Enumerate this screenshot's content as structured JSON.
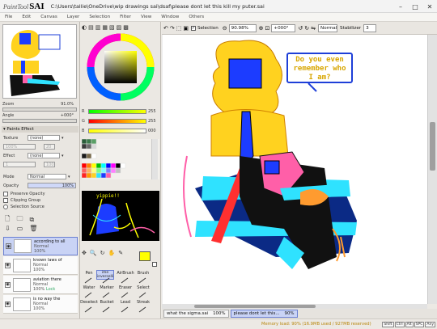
{
  "app": {
    "logo_small": "PaintTool",
    "logo_big": "SAI",
    "title": "C:\\Users\\tallie\\OneDrive\\wip drawings sai\\dsaf\\please dont let this kill my puter.sai"
  },
  "window_buttons": [
    "–",
    "□",
    "✕"
  ],
  "menu": [
    "File",
    "Edit",
    "Canvas",
    "Layer",
    "Selection",
    "Filter",
    "View",
    "Window",
    "Others"
  ],
  "navigator": {
    "zoom_label": "Zoom",
    "zoom_value": "91.0%",
    "angle_label": "Angle",
    "angle_value": "+000°"
  },
  "color": {
    "r_label": "R",
    "r_value": "255",
    "g_label": "G",
    "g_value": "255",
    "b_label": "B",
    "b_value": "000",
    "current": "#ffff00"
  },
  "paints_effect": {
    "header": "Paints Effect",
    "texture_label": "Texture",
    "texture_value": "(none)",
    "scale_label": "Scale",
    "scale_value": "100%",
    "scale_num": "20",
    "effect_label": "Effect",
    "effect_value": "(none)",
    "width_label": "Width",
    "width_value": "1",
    "width_num": "100"
  },
  "layer_props": {
    "mode_label": "Mode",
    "mode_value": "Normal",
    "opacity_label": "Opacity",
    "opacity_value": "100%",
    "preserve_opacity": "Preserve Opacity",
    "clipping_group": "Clipping Group",
    "selection_source": "Selection Source"
  },
  "layers": [
    {
      "name": "according to all",
      "mode": "Normal",
      "opacity": "100%",
      "lock": ""
    },
    {
      "name": "known laws of",
      "mode": "Normal",
      "opacity": "100%",
      "lock": ""
    },
    {
      "name": "aviation there",
      "mode": "Normal",
      "opacity": "100%",
      "lock": "Lock"
    },
    {
      "name": "is no way the",
      "mode": "Normal",
      "opacity": "100%",
      "lock": ""
    }
  ],
  "tools": [
    "Pen",
    "ime\ninverselli",
    "AirBrush",
    "Brush",
    "Water",
    "Marker",
    "Eraser",
    "Select",
    "Deselect",
    "Bucket",
    "Lead",
    "Streak"
  ],
  "canvas_toolbar": {
    "selection_label": "Selection",
    "zoom": "90.98%",
    "angle": "+000°",
    "mode": "Normal",
    "stabilizer_label": "Stabilizer",
    "stabilizer_value": "3"
  },
  "speech_bubble": "Do you even remember who I am?",
  "ref_image_text": "yippie!!",
  "tabs": [
    {
      "name": "what the sigma.sai",
      "zoom": "100%"
    },
    {
      "name": "please dont let this...",
      "zoom": "90%"
    }
  ],
  "status": {
    "memory": "Memory load: 90% (16.9MB used / 927MB reserved)",
    "keys": [
      "Shift",
      "Ctrl",
      "Alt",
      "SPC",
      "Any"
    ]
  }
}
